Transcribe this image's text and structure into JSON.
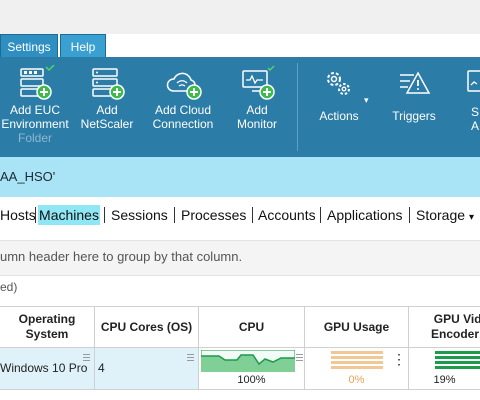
{
  "menu_tabs": [
    {
      "label": "Settings"
    },
    {
      "label": "Help"
    }
  ],
  "ribbon": {
    "add_euc": {
      "line1": "Add EUC",
      "line2": "Environment",
      "line3": "Folder"
    },
    "add_netscaler": {
      "line1": "Add",
      "line2": "NetScaler"
    },
    "add_cloud": {
      "line1": "Add Cloud",
      "line2": "Connection"
    },
    "add_monitor": {
      "line1": "Add",
      "line2": "Monitor"
    },
    "actions": {
      "label": "Actions"
    },
    "triggers": {
      "label": "Triggers"
    },
    "script_actions": {
      "line1": "S",
      "line2": "A"
    }
  },
  "path": "AA_HSO'",
  "nav_tabs": [
    "Hosts",
    "Machines",
    "Sessions",
    "Processes",
    "Accounts",
    "Applications",
    "Storage"
  ],
  "group_hint": "umn header here to group by that column.",
  "filter_text": "ed)",
  "columns": [
    {
      "line1": "Operating",
      "line2": "System"
    },
    {
      "line1": "CPU Cores (OS)",
      "line2": ""
    },
    {
      "line1": "CPU",
      "line2": ""
    },
    {
      "line1": "GPU Usage",
      "line2": ""
    },
    {
      "line1": "GPU Vide",
      "line2": "Encoder U"
    }
  ],
  "row": {
    "os": "Windows 10 Pro",
    "cpu_cores": "4",
    "cpu": {
      "percent_label": "100%",
      "percent": 100
    },
    "gpu_usage": {
      "percent_label": "0%",
      "percent": 0
    },
    "gpu_encoder": {
      "percent_label": "19%",
      "percent": 19
    }
  },
  "colors": {
    "ribbon": "#2b7ca6",
    "path_bar": "#a9e3f6",
    "active_nav": "#8fe6f4",
    "cpu_green": "#1a9c4a",
    "gpu_orange": "#e6a35c"
  }
}
